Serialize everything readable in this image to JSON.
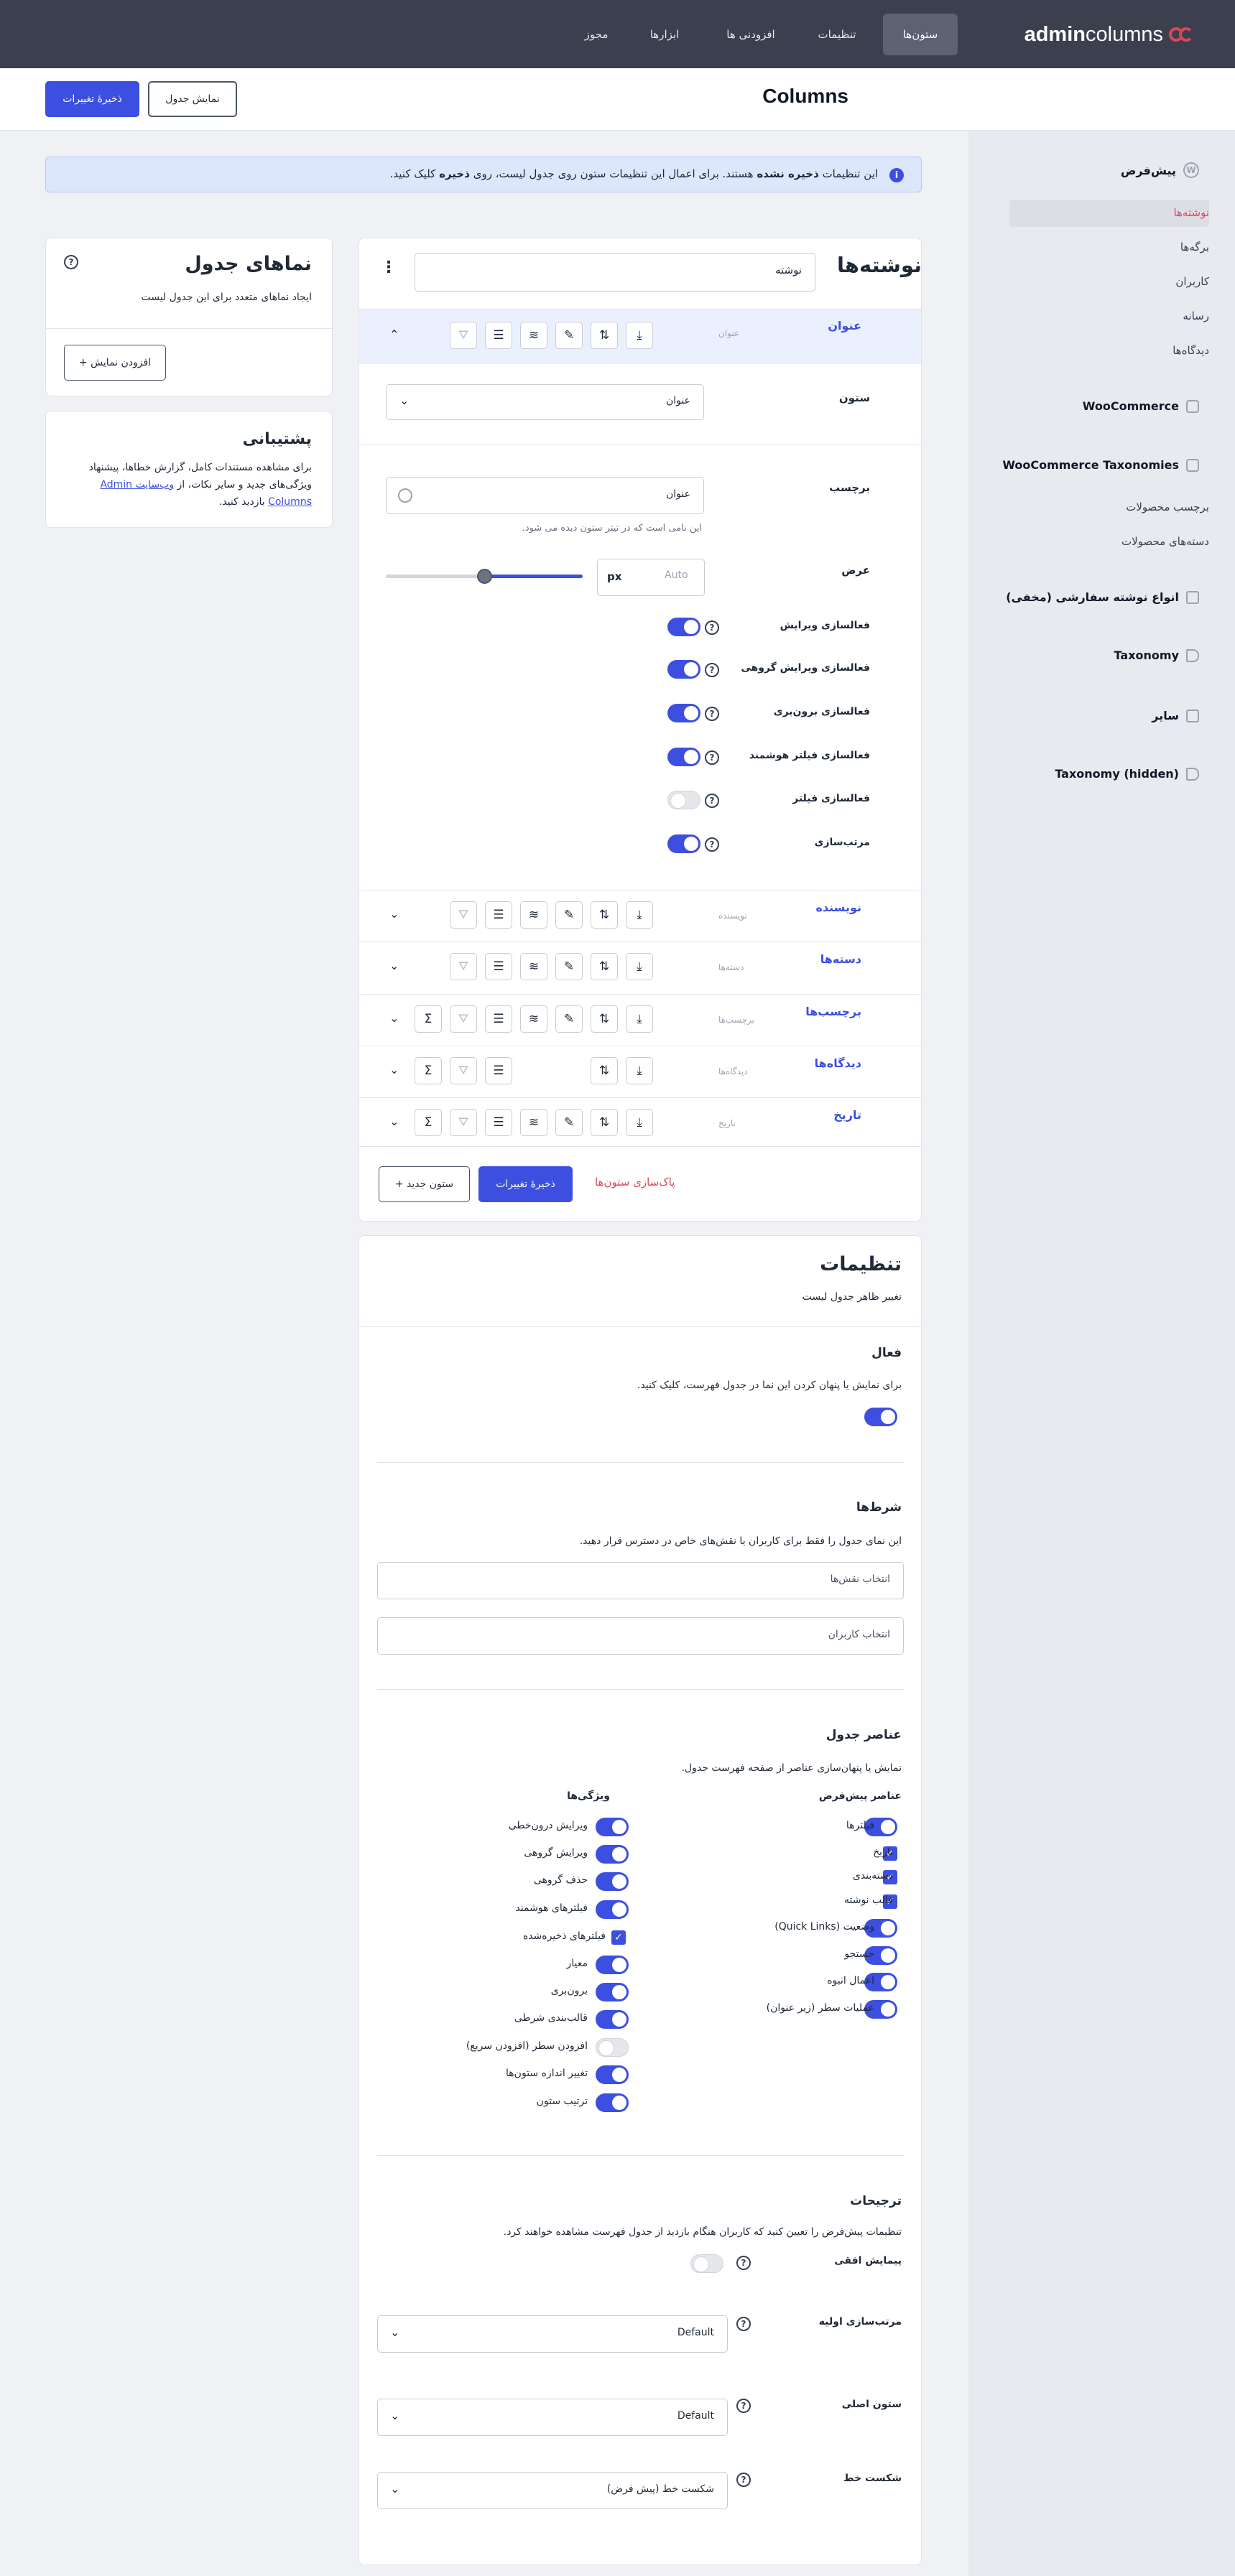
{
  "logo": {
    "text_a": "admin",
    "text_b": "columns"
  },
  "topnav": [
    "ستون‌ها",
    "تنظیمات",
    "افزودنی ها",
    "ابزارها",
    "مجوز"
  ],
  "subheader": {
    "title": "Columns",
    "view_table": "نمایش جدول",
    "save": "ذخیرهٔ تغییرات"
  },
  "sidebar": {
    "default_group": "پیش‌فرض",
    "default_items": [
      "نوشته‌ها",
      "برگه‌ها",
      "کاربران",
      "رسانه",
      "دیدگاه‌ها"
    ],
    "woocommerce": "WooCommerce",
    "woo_tax": "WooCommerce Taxonomies",
    "woo_tax_items": [
      "برچسب محصولات",
      "دسته‌های محصولات"
    ],
    "hidden_post_types": "انواع نوشته سفارشی (مخفی)",
    "taxonomy": "Taxonomy",
    "other": "سایر",
    "taxonomy_hidden": "Taxonomy (hidden)"
  },
  "notice": {
    "prefix": "این تنظیمات",
    "bold": "ذخیره نشده",
    "mid": "هستند. برای اعمال این تنظیمات ستون روی جدول لیست، روی",
    "bold2": "ذخیره",
    "suffix": "کلیک کنید."
  },
  "views": {
    "title": "نماهای جدول",
    "desc": "ایجاد نماهای متعدد برای این جدول لیست",
    "add": "+ افزودن نمایش"
  },
  "support": {
    "title": "پشتیبانی",
    "line1": "برای مشاهده مستندات کامل، گزارش خطاها، پیشنهاد",
    "line2_a": "ویژگی‌های جدید و سایر نکات، از",
    "link": "وب‌سایت Admin",
    "line3_link": "Columns",
    "line3": "بازدید کنید."
  },
  "posts": {
    "title": "نوشته‌ها",
    "view_name": "نوشته",
    "expanded": {
      "name": "عنوان",
      "type": "عنوان",
      "column_label": "ستون",
      "column_value": "عنوان",
      "label_label": "برچسب",
      "label_value": "عنوان",
      "label_hint": "این نامی است که در تیتر ستون دیده می شود.",
      "width_label": "عرض",
      "width_value": "Auto",
      "width_unit": "px",
      "options": [
        {
          "label": "فعالسازی ویرایش",
          "on": true
        },
        {
          "label": "فعالسازی ویرایش گروهی",
          "on": true
        },
        {
          "label": "فعالسازی برون‌بری",
          "on": true
        },
        {
          "label": "فعالسازی فیلتر هوشمند",
          "on": true
        },
        {
          "label": "فعالسازی فیلتر",
          "on": false
        },
        {
          "label": "مرتب‌سازی",
          "on": true
        }
      ]
    },
    "columns": [
      {
        "name": "نویسنده",
        "type": "نویسنده"
      },
      {
        "name": "دسته‌ها",
        "type": "دسته‌ها"
      },
      {
        "name": "برچسب‌ها",
        "type": "برچسب‌ها"
      },
      {
        "name": "دیدگاه‌ها",
        "type": "دیدگاه‌ها"
      },
      {
        "name": "تاریخ",
        "type": "تاریخ"
      }
    ],
    "reset": "پاک‌سازی ستون‌ها",
    "save": "ذخیرهٔ تغییرات",
    "add": "+ ستون جدید"
  },
  "settings": {
    "title": "تنظیمات",
    "desc": "تغییر ظاهر جدول لیست",
    "active_title": "فعال",
    "active_desc": "برای نمایش یا پنهان کردن این نما در جدول فهرست، کلیک کنید.",
    "cond_title": "شرط‌ها",
    "cond_desc": "این نمای جدول را فقط برای کاربران یا نقش‌های خاص در دسترس قرار دهید.",
    "roles_placeholder": "انتخاب نقش‌ها",
    "users_placeholder": "انتخاب کاربران",
    "elements_title": "عناصر جدول",
    "elements_desc": "نمایش یا پنهان‌سازی عناصر از صفحه فهرست جدول.",
    "defaults_head": "عناصر پیش‌فرض",
    "features_head": "ویژگی‌ها",
    "defaults": [
      {
        "label": "فیلترها",
        "kind": "toggle"
      },
      {
        "label": "تاریخ",
        "kind": "check"
      },
      {
        "label": "دسته‌بندی",
        "kind": "check"
      },
      {
        "label": "قالب نوشته",
        "kind": "check"
      },
      {
        "label": "وضعیت (Quick Links)",
        "kind": "toggle"
      },
      {
        "label": "جستجو",
        "kind": "toggle"
      },
      {
        "label": "اعمال انبوه",
        "kind": "toggle"
      },
      {
        "label": "عملیات سطر (زیر عنوان)",
        "kind": "toggle"
      }
    ],
    "features": [
      {
        "label": "ویرایش درون‌خطی",
        "kind": "toggle"
      },
      {
        "label": "ویرایش گروهی",
        "kind": "toggle"
      },
      {
        "label": "حذف گروهی",
        "kind": "toggle"
      },
      {
        "label": "فیلترهای هوشمند",
        "kind": "toggle"
      },
      {
        "label": "فیلترهای ذخیره‌شده",
        "kind": "check"
      },
      {
        "label": "معیار",
        "kind": "toggle"
      },
      {
        "label": "برون‌بری",
        "kind": "toggle"
      },
      {
        "label": "قالب‌بندی شرطی",
        "kind": "toggle"
      },
      {
        "label": "افزودن سطر (افزودن سریع)",
        "kind": "off"
      },
      {
        "label": "تغییر اندازه ستون‌ها",
        "kind": "toggle"
      },
      {
        "label": "ترتیب ستون",
        "kind": "toggle"
      }
    ],
    "prefs_title": "ترجیحات",
    "prefs_desc": "تنظیمات پیش‌فرض را تعیین کنید که کاربران هنگام بازدید از جدول فهرست مشاهده خواهند کرد.",
    "hscroll": "پیمایش افقی",
    "sorting_label": "مرتب‌سازی اولیه",
    "sorting_value": "Default",
    "primary_label": "ستون اصلی",
    "primary_value": "Default",
    "wrap_label": "شکست خط",
    "wrap_value": "شکست خط (پیش فرض)"
  }
}
